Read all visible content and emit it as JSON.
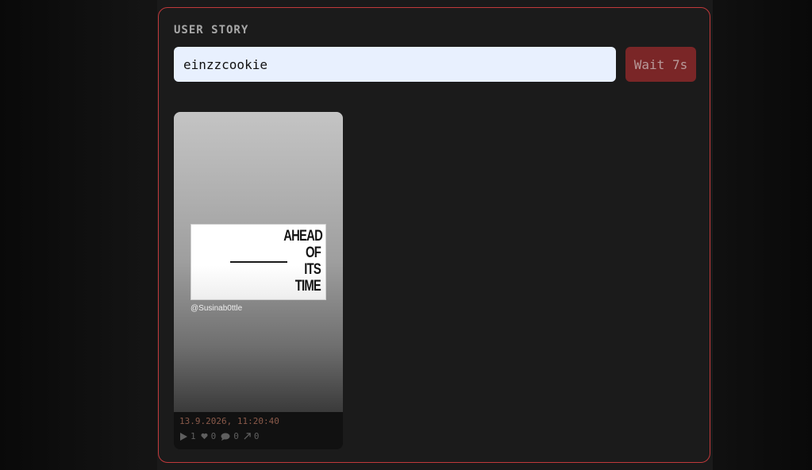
{
  "panel": {
    "title": "USER STORY"
  },
  "search": {
    "value": "einzzcookie"
  },
  "wait_button": {
    "label": "Wait 7s"
  },
  "story": {
    "thumbnail_text_lines": [
      "AHEAD",
      "OF",
      "ITS",
      "TIME"
    ],
    "handle": "@Susinab0ttle",
    "date": "13.9.2026, 11:20:40",
    "stats": {
      "plays": "1",
      "likes": "0",
      "comments": "0",
      "shares": "0"
    }
  },
  "colors": {
    "accent_border": "#c0393b",
    "button_bg": "#7a2627",
    "input_bg": "#e8f0fe",
    "date_text": "#8a5a4a"
  },
  "icons": {
    "plays": "play-icon",
    "likes": "heart-icon",
    "comments": "comment-icon",
    "shares": "share-icon"
  }
}
